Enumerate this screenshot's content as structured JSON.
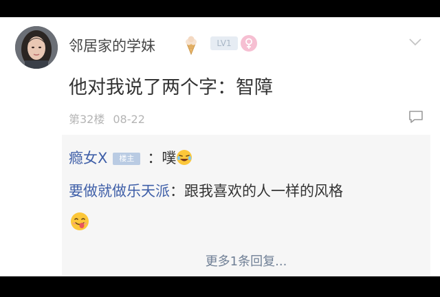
{
  "post": {
    "username": "邻居家的学妹",
    "level_badge": "LV1",
    "text": "他对我说了两个字：智障",
    "floor": "第32楼",
    "date": "08-22"
  },
  "replies": [
    {
      "name": "瘾女X",
      "badge": "楼主",
      "separator": "：",
      "text": "噗"
    },
    {
      "name": "要做就做乐天派",
      "separator": "：",
      "text": "跟我喜欢的人一样的风格"
    }
  ],
  "more_replies": "更多1条回复...",
  "icons": {
    "badge": "ice-cream-icon",
    "gender": "female-icon",
    "expand": "chevron-down-icon",
    "comment": "comment-icon",
    "emoji_1": "laugh-cry-emoji",
    "emoji_2": "tongue-emoji"
  },
  "colors": {
    "link": "#3f5fa8",
    "badge_bg": "#b9cbe3",
    "meta": "#b4b4b4",
    "gender": "#f6bfd2"
  }
}
